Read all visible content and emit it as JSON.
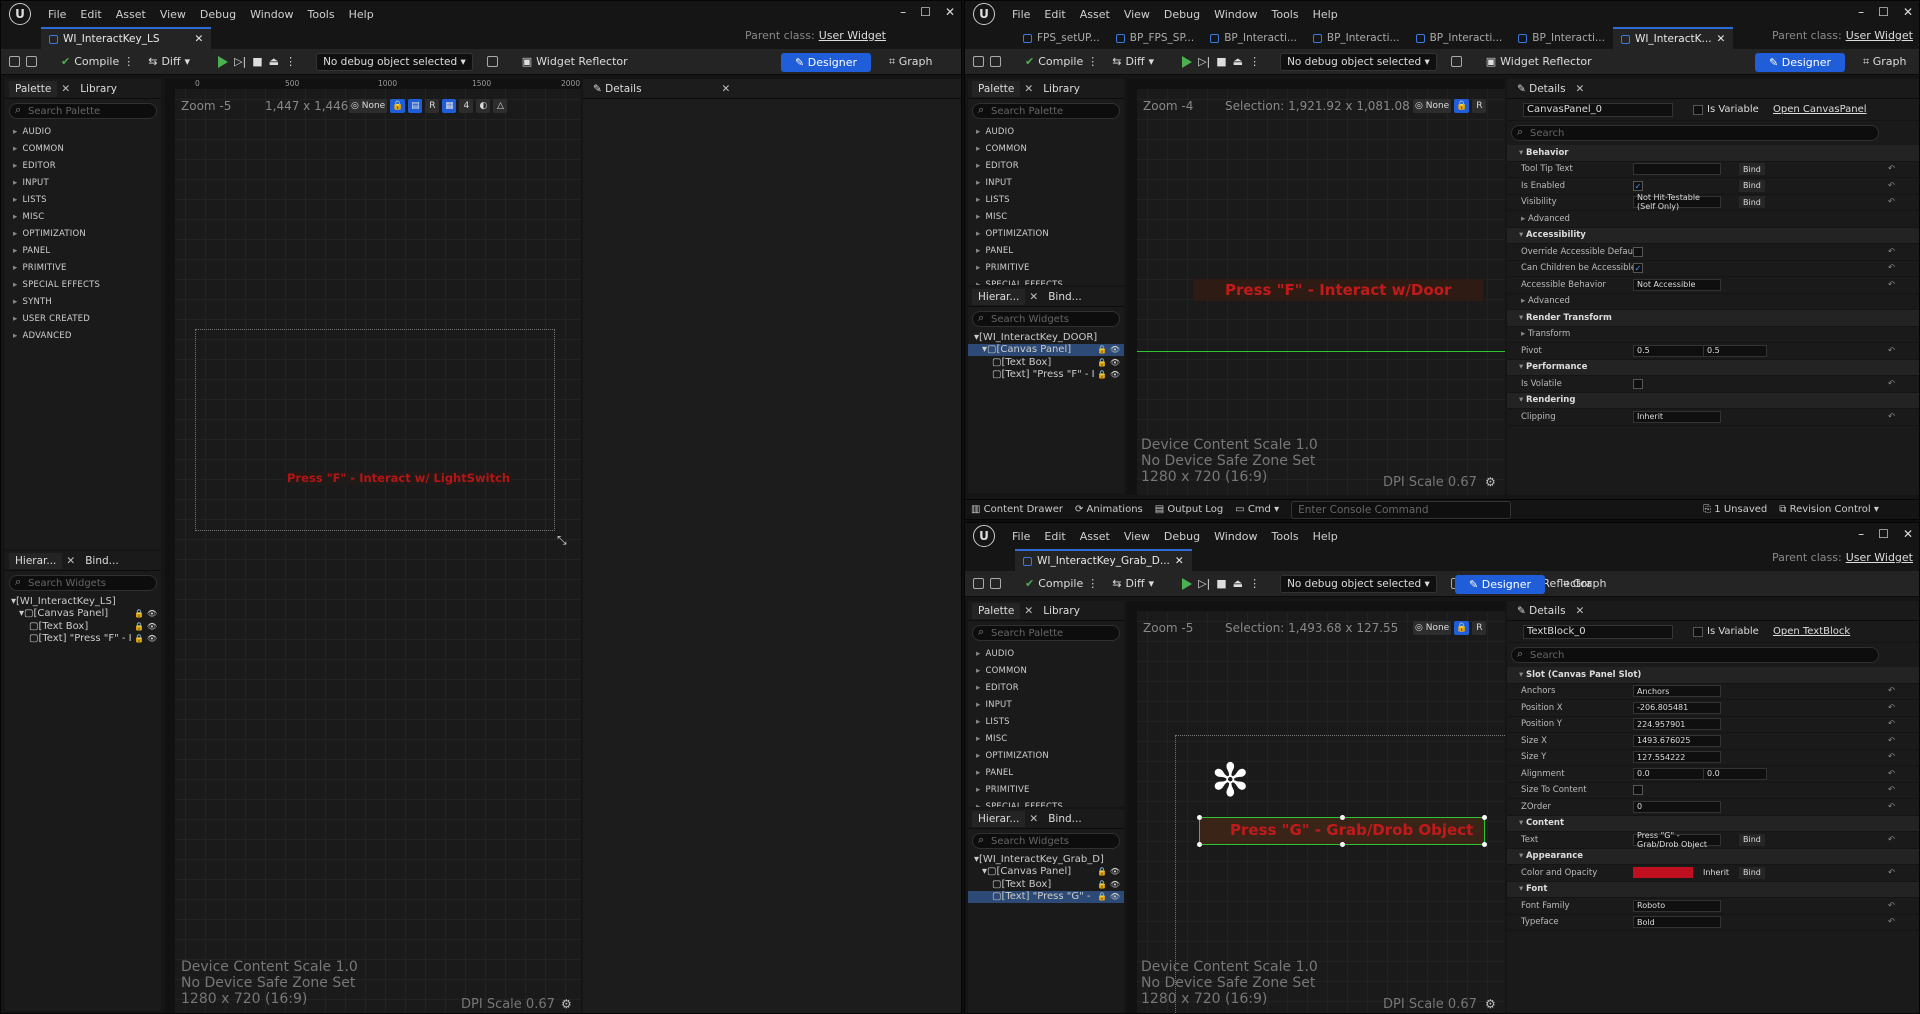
{
  "colors": {
    "accent": "#1f5ed8",
    "widget_text_red": "#c21a1a",
    "selection_green": "#2ec62e",
    "color_swatch": "#c01020"
  },
  "menu": [
    "File",
    "Edit",
    "Asset",
    "View",
    "Debug",
    "Window",
    "Tools",
    "Help"
  ],
  "parent_class_label": "Parent class:",
  "parent_class_value": "User Widget",
  "toolbar": {
    "compile": "Compile",
    "diff": "Diff",
    "debug_select": "No debug object selected",
    "widget_reflector": "Widget Reflector",
    "designer": "Designer",
    "graph": "Graph"
  },
  "palette": {
    "tab": "Palette",
    "library_tab": "Library",
    "search_placeholder": "Search Palette",
    "categories": [
      "AUDIO",
      "COMMON",
      "EDITOR",
      "INPUT",
      "LISTS",
      "MISC",
      "OPTIMIZATION",
      "PANEL",
      "PRIMITIVE",
      "SPECIAL EFFECTS",
      "SYNTH",
      "USER CREATED",
      "ADVANCED"
    ]
  },
  "hierarchy": {
    "tab": "Hierar...",
    "bind_tab": "Bind...",
    "search_placeholder": "Search Widgets"
  },
  "window1": {
    "tab_title": "WI_InteractKey_LS",
    "zoom": "Zoom -5",
    "resolution_readout": "1,447 x 1,446",
    "widget_text": "Press \"F\" - Interact w/ LightSwitch",
    "ruler_labels": [
      "0",
      "500",
      "1000",
      "1500",
      "2000"
    ],
    "hierarchy_items": [
      "[WI_InteractKey_LS]",
      "[Canvas Panel]",
      "[Text Box]",
      "[Text] \"Press \"F\" - I"
    ],
    "details_title": "Details",
    "footer": [
      "Device Content Scale 1.0",
      "No Device Safe Zone Set",
      "1280 x 720 (16:9)"
    ],
    "dpi": "DPI Scale 0.67"
  },
  "window2": {
    "tabs": [
      "FPS_setUP...",
      "BP_FPS_SP...",
      "BP_Interacti...",
      "BP_Interacti...",
      "BP_Interacti...",
      "BP_Interacti...",
      "WI_InteractK..."
    ],
    "zoom": "Zoom -4",
    "selection": "Selection: 1,921.92 x 1,081.08",
    "widget_text": "Press \"F\" - Interact w/Door",
    "hierarchy_items": [
      "[WI_InteractKey_DOOR]",
      "[Canvas Panel]",
      "[Text Box]",
      "[Text] \"Press \"F\" - I"
    ],
    "footer": [
      "Device Content Scale 1.0",
      "No Device Safe Zone Set",
      "1280 x 720 (16:9)"
    ],
    "dpi": "DPI Scale 0.67",
    "details": {
      "name": "CanvasPanel_0",
      "is_variable": "Is Variable",
      "open_link": "Open CanvasPanel",
      "search": "Search",
      "rows": [
        {
          "type": "sec",
          "label": "Behavior"
        },
        {
          "type": "row",
          "label": "Tool Tip Text",
          "value": "",
          "bind": "Bind"
        },
        {
          "type": "check",
          "label": "Is Enabled",
          "checked": "✓",
          "bind": "Bind"
        },
        {
          "type": "row",
          "label": "Visibility",
          "value": "Not Hit-Testable (Self Only)",
          "bind": "Bind"
        },
        {
          "type": "sub",
          "label": "Advanced"
        },
        {
          "type": "sec",
          "label": "Accessibility"
        },
        {
          "type": "check",
          "label": "Override Accessible Defaults",
          "checked": ""
        },
        {
          "type": "check",
          "label": "Can Children be Accessible",
          "checked": "✓"
        },
        {
          "type": "row",
          "label": "Accessible Behavior",
          "value": "Not Accessible"
        },
        {
          "type": "sub",
          "label": "Advanced"
        },
        {
          "type": "sec",
          "label": "Render Transform"
        },
        {
          "type": "sub",
          "label": "Transform"
        },
        {
          "type": "row2",
          "label": "Pivot",
          "value": "0.5",
          "value2": "0.5"
        },
        {
          "type": "sec",
          "label": "Performance"
        },
        {
          "type": "check",
          "label": "Is Volatile",
          "checked": ""
        },
        {
          "type": "sec",
          "label": "Rendering"
        },
        {
          "type": "row",
          "label": "Clipping",
          "value": "Inherit"
        }
      ]
    }
  },
  "statusbar": {
    "content_drawer": "Content Drawer",
    "animations": "Animations",
    "output_log": "Output Log",
    "cmd": "Cmd",
    "console_placeholder": "Enter Console Command",
    "unsaved": "1 Unsaved",
    "revision": "Revision Control"
  },
  "window3": {
    "tab_title": "WI_InteractKey_Grab_D...",
    "zoom": "Zoom -5",
    "selection": "Selection: 1,493.68 x 127.55",
    "widget_text": "Press \"G\" - Grab/Drob Object",
    "hierarchy_items": [
      "[WI_InteractKey_Grab_D]",
      "[Canvas Panel]",
      "[Text Box]",
      "[Text] \"Press \"G\" -"
    ],
    "footer": [
      "Device Content Scale 1.0",
      "No Device Safe Zone Set",
      "1280 x 720 (16:9)"
    ],
    "dpi": "DPI Scale 0.67",
    "details": {
      "name": "TextBlock_0",
      "is_variable": "Is Variable",
      "open_link": "Open TextBlock",
      "search": "Search",
      "rows": [
        {
          "type": "sec",
          "label": "Slot (Canvas Panel Slot)"
        },
        {
          "type": "row",
          "label": "Anchors",
          "value": "Anchors"
        },
        {
          "type": "row",
          "label": "Position X",
          "value": "-206.805481"
        },
        {
          "type": "row",
          "label": "Position Y",
          "value": "224.957901"
        },
        {
          "type": "row",
          "label": "Size X",
          "value": "1493.676025"
        },
        {
          "type": "row",
          "label": "Size Y",
          "value": "127.554222"
        },
        {
          "type": "row2",
          "label": "Alignment",
          "value": "0.0",
          "value2": "0.0"
        },
        {
          "type": "check",
          "label": "Size To Content",
          "checked": ""
        },
        {
          "type": "row",
          "label": "ZOrder",
          "value": "0"
        },
        {
          "type": "sec",
          "label": "Content"
        },
        {
          "type": "row",
          "label": "Text",
          "value": "Press \"G\" - Grab/Drob Object",
          "bind": "Bind"
        },
        {
          "type": "sec",
          "label": "Appearance"
        },
        {
          "type": "color",
          "label": "Color and Opacity",
          "value": "Inherit",
          "bind": "Bind"
        },
        {
          "type": "sec",
          "label": "Font"
        },
        {
          "type": "row",
          "label": "Font Family",
          "value": "Roboto"
        },
        {
          "type": "row",
          "label": "Typeface",
          "value": "Bold"
        }
      ]
    }
  }
}
